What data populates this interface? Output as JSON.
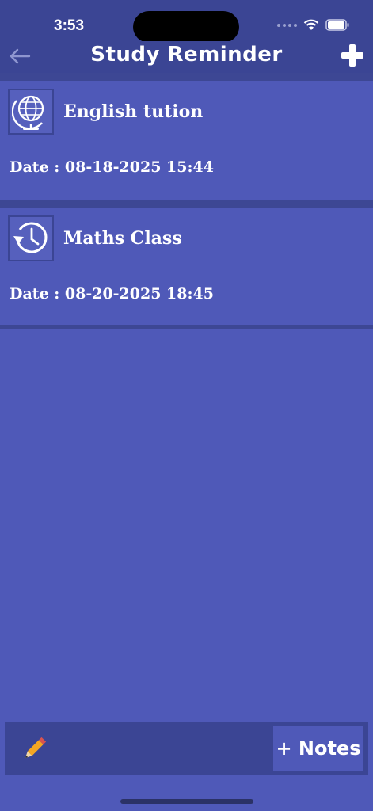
{
  "status": {
    "time": "3:53"
  },
  "header": {
    "title": "Study Reminder"
  },
  "reminders": [
    {
      "icon": "globe-icon",
      "title": "English tution",
      "date": "Date : 08-18-2025 15:44"
    },
    {
      "icon": "history-clock-icon",
      "title": "Maths Class",
      "date": "Date : 08-20-2025 18:45"
    }
  ],
  "footer": {
    "notes_label": "+ Notes"
  },
  "colors": {
    "background": "#4f59b8",
    "bar": "#3b4594",
    "pencil": "#f5a623"
  }
}
